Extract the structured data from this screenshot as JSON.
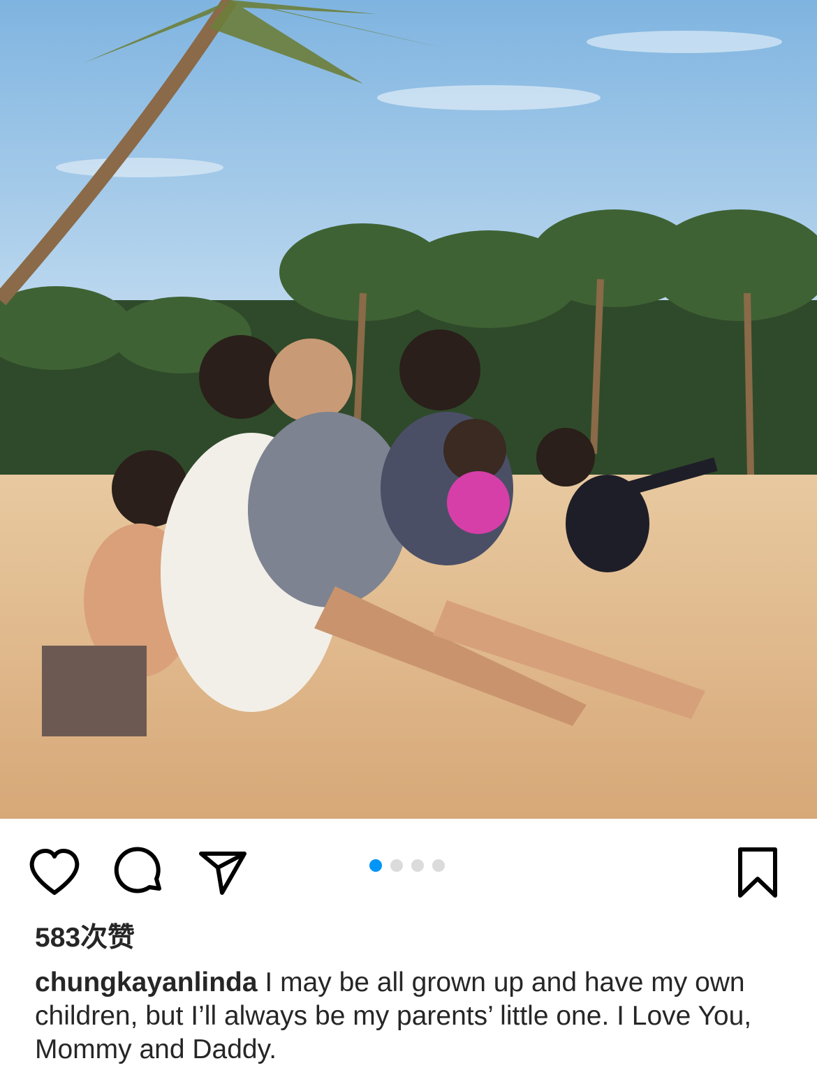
{
  "post": {
    "likes_text": "583次赞",
    "username": "chungkayanlinda",
    "caption_text": " I may be all grown up and have my own children, but I’ll always be my parents’ little one.  I Love You, Mommy and Daddy.",
    "carousel": {
      "total": 4,
      "active_index": 0
    }
  },
  "actions": {
    "like_icon": "heart-icon",
    "comment_icon": "comment-icon",
    "share_icon": "paper-plane-icon",
    "save_icon": "bookmark-icon"
  },
  "colors": {
    "active_dot": "#0095f6",
    "inactive_dot": "#dbdbdb",
    "text": "#262626"
  }
}
